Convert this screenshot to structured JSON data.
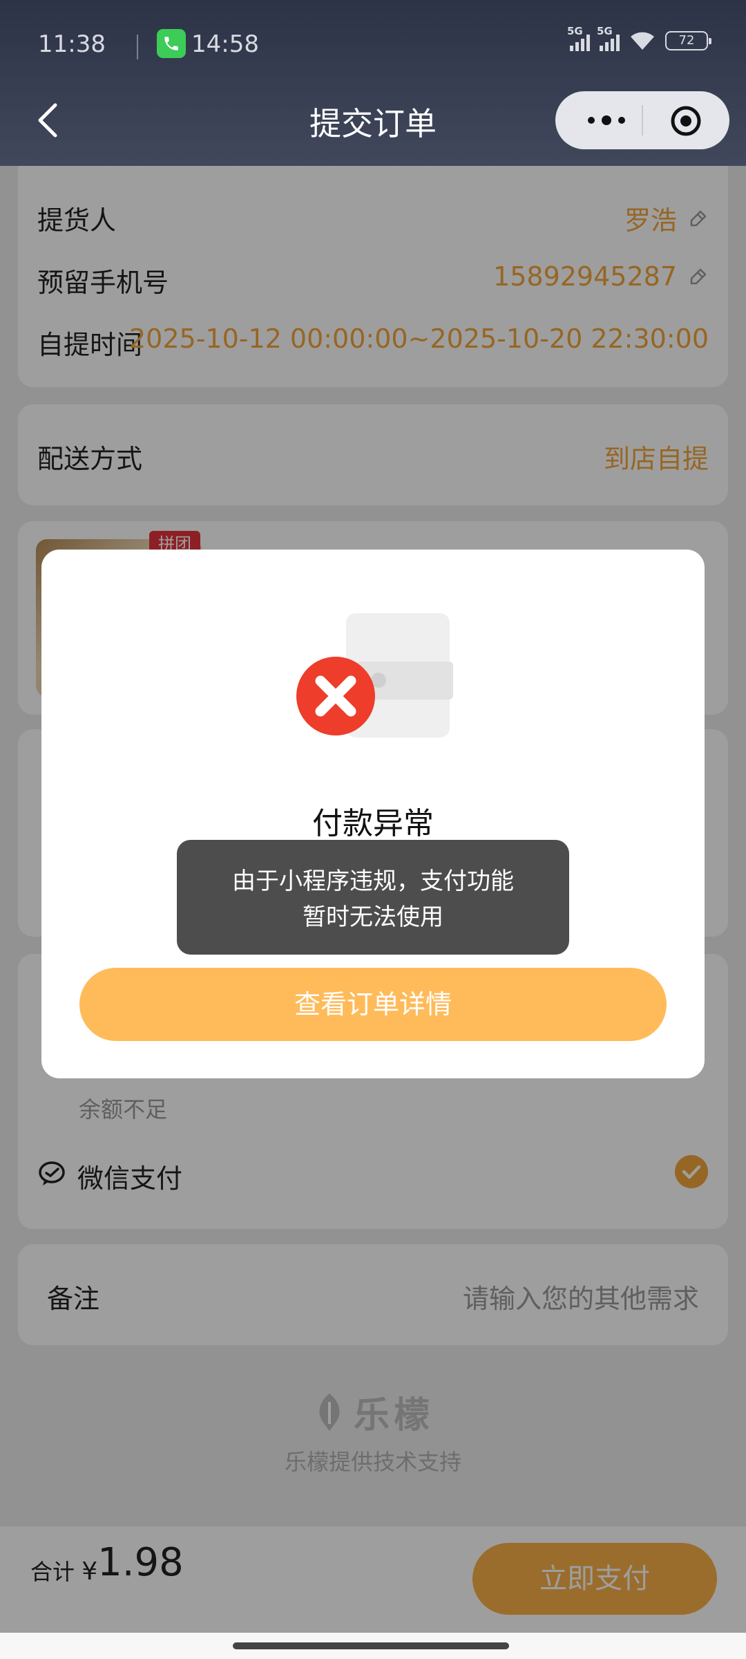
{
  "status_bar": {
    "time": "11:38",
    "call_time": "14:58",
    "signal_1": "5G",
    "signal_2": "5G",
    "battery": "72"
  },
  "nav": {
    "title": "提交订单"
  },
  "pickup": {
    "person_label": "提货人",
    "person_value": "罗浩",
    "phone_label": "预留手机号",
    "phone_value": "15892945287",
    "time_label": "自提时间",
    "time_value": "2025-10-12 00:00:00~2025-10-20 22:30:00"
  },
  "delivery": {
    "label": "配送方式",
    "value": "到店自提"
  },
  "product": {
    "tag": "拼团"
  },
  "payment": {
    "balance_note": "余额不足",
    "wechat_label": "微信支付"
  },
  "remark": {
    "label": "备注",
    "placeholder": "请输入您的其他需求"
  },
  "footer_brand": {
    "name": "乐檬",
    "support": "乐檬提供技术支持"
  },
  "bottom_bar": {
    "total_label": "合计",
    "currency": "¥",
    "total_value": "1.98",
    "pay_button": "立即支付"
  },
  "modal": {
    "title": "付款异常",
    "button": "查看订单详情"
  },
  "toast": {
    "line1": "由于小程序违规，支付功能",
    "line2": "暂时无法使用"
  },
  "colors": {
    "accent": "#f3a53b",
    "modal_button": "#ffbb5a",
    "error": "#ee3d2b"
  }
}
